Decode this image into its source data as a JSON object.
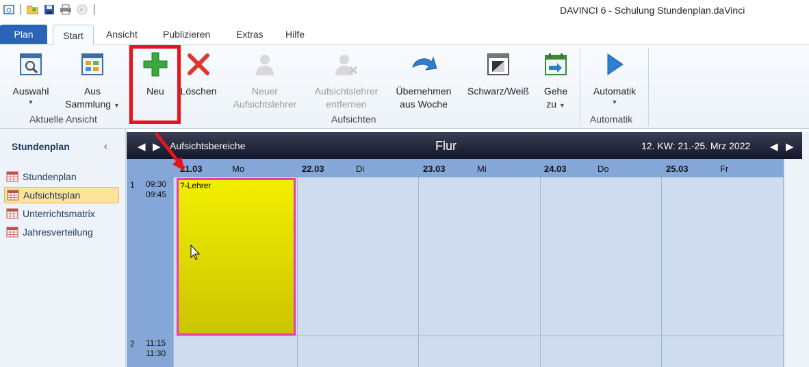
{
  "window": {
    "title": "DAVINCI 6 - Schulung Stundenplan.daVinci"
  },
  "ribbon_tabs": [
    "Plan",
    "Start",
    "Ansicht",
    "Publizieren",
    "Extras",
    "Hilfe"
  ],
  "ribbon": {
    "auswahl": "Auswahl",
    "aus_sammlung_1": "Aus",
    "aus_sammlung_2": "Sammlung",
    "group_aktuelle_ansicht": "Aktuelle Ansicht",
    "neu": "Neu",
    "loeschen": "Löschen",
    "neuer_1": "Neuer",
    "neuer_2": "Aufsichtslehrer",
    "entfernen_1": "Aufsichtslehrer",
    "entfernen_2": "entfernen",
    "uebernehmen_1": "Übernehmen",
    "uebernehmen_2": "aus Woche",
    "schwarzweiss": "Schwarz/Weiß",
    "gehe_1": "Gehe",
    "gehe_2": "zu",
    "group_aufsichten": "Aufsichten",
    "automatik": "Automatik",
    "group_automatik": "Automatik"
  },
  "sidebar": {
    "title": "Stundenplan",
    "collapse": "‹",
    "items": [
      "Stundenplan",
      "Aufsichtsplan",
      "Unterrichtsmatrix",
      "Jahresverteilung"
    ],
    "active_index": 1
  },
  "calendar": {
    "area_label": "Aufsichtsbereiche",
    "room": "Flur",
    "week": "12. KW: 21.-25. Mrz 2022",
    "days": [
      {
        "date": "21.03",
        "name": "Mo"
      },
      {
        "date": "22.03",
        "name": "Di"
      },
      {
        "date": "23.03",
        "name": "Mi"
      },
      {
        "date": "24.03",
        "name": "Do"
      },
      {
        "date": "25.03",
        "name": "Fr"
      }
    ],
    "slots": [
      {
        "num": "1",
        "start": "09:30",
        "end": "09:45"
      },
      {
        "num": "2",
        "start": "11:15",
        "end": "11:30"
      }
    ],
    "appointment": {
      "label": "?-Lehrer",
      "day": "Mo",
      "slot": "1"
    }
  },
  "colors": {
    "highlight": "#e8141b",
    "appointment_fill": "#f2ef00",
    "appointment_border": "#e83cb0",
    "accent": "#2a63b8"
  }
}
